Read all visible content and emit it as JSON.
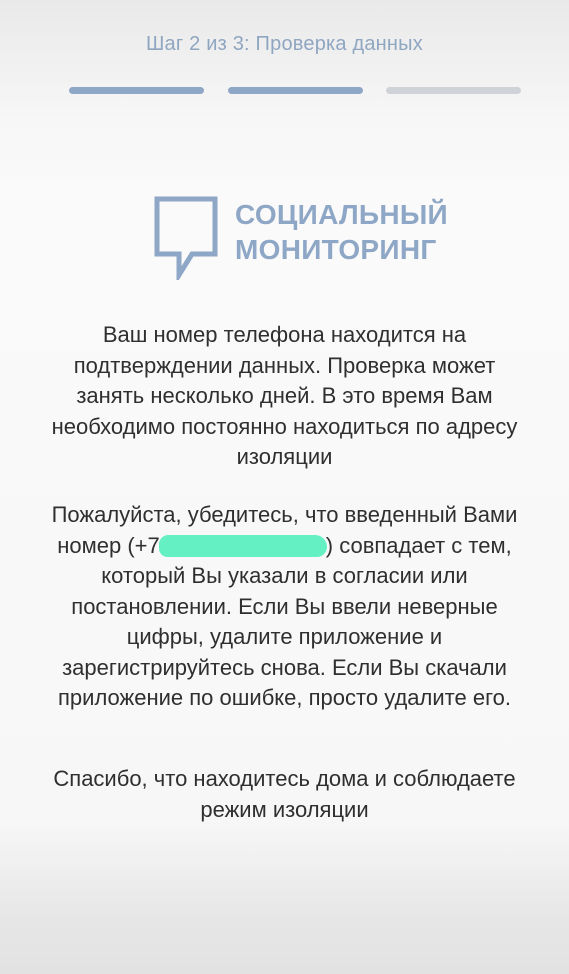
{
  "header": {
    "step_title": "Шаг 2 из 3: Проверка данных",
    "progress": {
      "current_step": 2,
      "total_steps": 3
    },
    "colors": {
      "active": "#8ea7c6",
      "inactive": "#cfd3d8"
    }
  },
  "logo": {
    "icon": "speech-bubble-icon",
    "line1": "СОЦИАЛЬНЫЙ",
    "line2": "МОНИТОРИНГ",
    "color": "#8ea7c6"
  },
  "message": {
    "paragraph1": "Ваш номер телефона находится на подтверждении данных. Проверка может занять несколько дней. В это время Вам необходимо постоянно находиться по адресу изоляции",
    "paragraph2_before": "Пожалуйста, убедитесь, что введенный Вами номер (+7",
    "paragraph2_after": ") совпадает с тем, который Вы указали в согласии или постановлении. Если Вы ввели неверные цифры, удалите приложение и зарегистрируйтесь снова. Если Вы скачали приложение по ошибке, просто удалите его.",
    "paragraph3": "Спасибо, что находитесь дома и соблюдаете режим изоляции"
  }
}
